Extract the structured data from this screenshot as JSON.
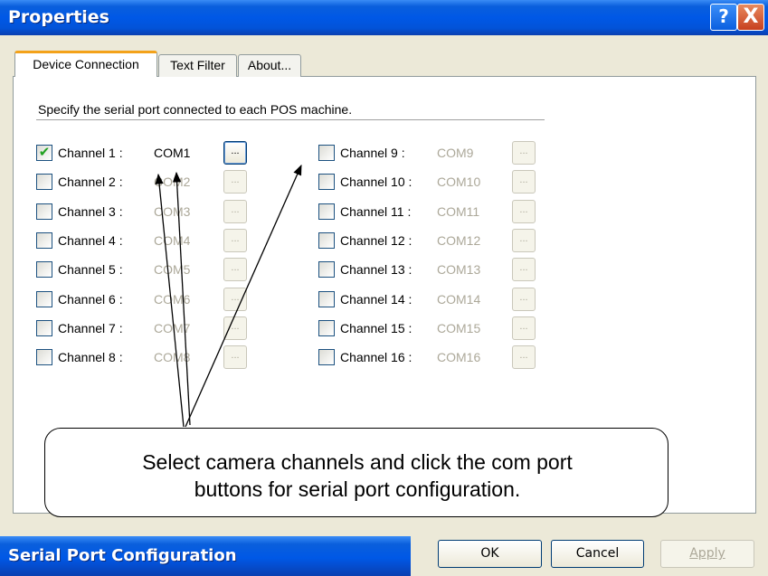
{
  "window": {
    "title": "Properties",
    "help_icon": "?",
    "close_icon": "X"
  },
  "tabs": [
    {
      "label": "Device Connection",
      "active": true
    },
    {
      "label": "Text Filter",
      "active": false
    },
    {
      "label": "About...",
      "active": false
    }
  ],
  "instruction": "Specify the serial port connected to each POS machine.",
  "channels": [
    {
      "label": "Channel 1 :",
      "port": "COM1",
      "checked": true
    },
    {
      "label": "Channel 2 :",
      "port": "COM2",
      "checked": false
    },
    {
      "label": "Channel 3 :",
      "port": "COM3",
      "checked": false
    },
    {
      "label": "Channel 4 :",
      "port": "COM4",
      "checked": false
    },
    {
      "label": "Channel 5 :",
      "port": "COM5",
      "checked": false
    },
    {
      "label": "Channel 6 :",
      "port": "COM6",
      "checked": false
    },
    {
      "label": "Channel 7 :",
      "port": "COM7",
      "checked": false
    },
    {
      "label": "Channel 8 :",
      "port": "COM8",
      "checked": false
    },
    {
      "label": "Channel 9 :",
      "port": "COM9",
      "checked": false
    },
    {
      "label": "Channel 10 :",
      "port": "COM10",
      "checked": false
    },
    {
      "label": "Channel 11 :",
      "port": "COM11",
      "checked": false
    },
    {
      "label": "Channel 12 :",
      "port": "COM12",
      "checked": false
    },
    {
      "label": "Channel 13 :",
      "port": "COM13",
      "checked": false
    },
    {
      "label": "Channel 14 :",
      "port": "COM14",
      "checked": false
    },
    {
      "label": "Channel 15 :",
      "port": "COM15",
      "checked": false
    },
    {
      "label": "Channel 16 :",
      "port": "COM16",
      "checked": false
    }
  ],
  "port_button_label": "...",
  "callout": {
    "line1": "Select camera channels and click the com port",
    "line2": "buttons for serial port configuration."
  },
  "bottom_caption": "Serial Port Configuration",
  "buttons": {
    "ok": "OK",
    "cancel": "Cancel",
    "apply": "Apply"
  },
  "colors": {
    "titlebar": "#0058e6",
    "dialog_bg": "#ece9d8",
    "disabled_text": "#aca899",
    "check_green": "#21a121",
    "tab_accent": "#f3a21a"
  }
}
